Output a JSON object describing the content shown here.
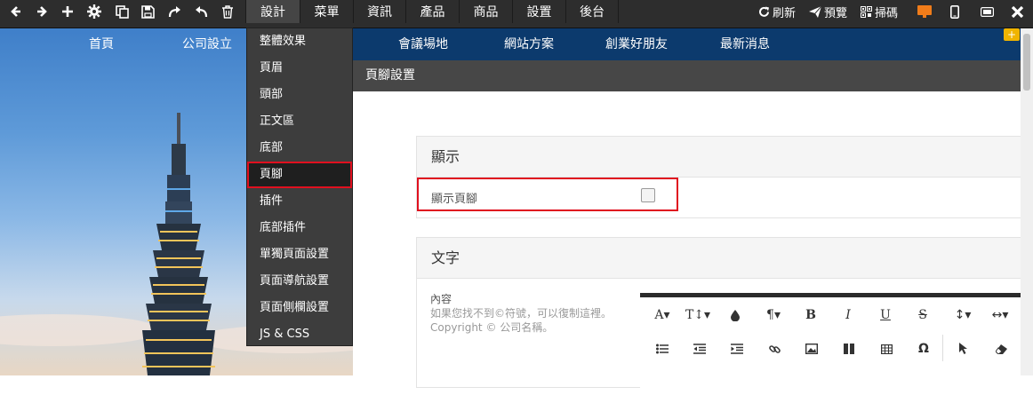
{
  "toolbar": {
    "menus": [
      {
        "label": "設計"
      },
      {
        "label": "菜單"
      },
      {
        "label": "資訊"
      },
      {
        "label": "產品"
      },
      {
        "label": "商品"
      },
      {
        "label": "設置"
      },
      {
        "label": "後台"
      }
    ],
    "refresh_label": "刷新",
    "preview_label": "預覽",
    "scan_label": "掃碼"
  },
  "site_nav": {
    "items_left": [
      "首頁",
      "公司設立"
    ],
    "items_right": [
      "會議場地",
      "網站方案",
      "創業好朋友",
      "最新消息"
    ]
  },
  "dropdown": {
    "items": [
      "整體效果",
      "頁眉",
      "頭部",
      "正文區",
      "底部",
      "頁腳",
      "插件",
      "底部插件",
      "單獨頁面設置",
      "頁面導航設置",
      "頁面側欄設置",
      "JS & CSS"
    ],
    "selected_index": 5
  },
  "panel": {
    "title": "頁腳設置",
    "display_section": {
      "heading": "顯示",
      "show_footer_label": "顯示頁腳",
      "show_footer_checked": false
    },
    "text_section": {
      "heading": "文字",
      "content_label": "內容",
      "content_hint": "如果您找不到©符號，可以復制這裡。Copyright © 公司名稱。"
    }
  },
  "editor": {
    "row1": [
      "A▾",
      "T↕▾",
      "",
      "¶▾",
      "B",
      "I",
      "U",
      "S",
      "↕▾",
      "↔▾"
    ],
    "row2": [
      "",
      "",
      "",
      "",
      "",
      "",
      "",
      "Ω",
      "",
      ""
    ]
  },
  "colors": {
    "toolbar_bg": "#2d2d2d",
    "highlight_red": "#e0101f",
    "site_nav_bg": "#0c3a6d",
    "badge": "#f0b400"
  },
  "badge_label": "+"
}
